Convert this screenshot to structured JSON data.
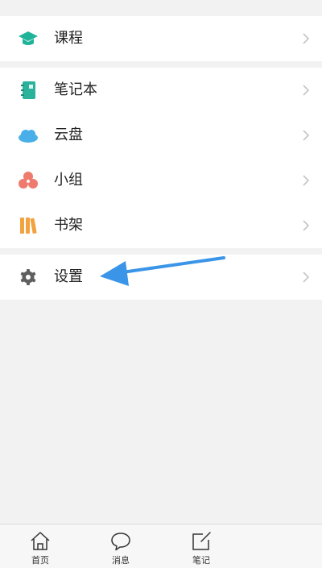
{
  "menu_groups": [
    {
      "items": [
        {
          "label": "课程",
          "icon": "graduation-cap-icon",
          "color": "#1fb39a"
        }
      ]
    },
    {
      "items": [
        {
          "label": "笔记本",
          "icon": "notebook-icon",
          "color": "#2ab39a"
        },
        {
          "label": "云盘",
          "icon": "cloud-icon",
          "color": "#4aaee8"
        },
        {
          "label": "小组",
          "icon": "group-icon",
          "color": "#ee7b6d"
        },
        {
          "label": "书架",
          "icon": "bookshelf-icon",
          "color": "#f3a240"
        }
      ]
    },
    {
      "items": [
        {
          "label": "设置",
          "icon": "gear-icon",
          "color": "#5f5f5f"
        }
      ]
    }
  ],
  "annotation": {
    "icon": "pointer-arrow",
    "color": "#3a95e8"
  },
  "tab_bar": {
    "tabs": [
      {
        "label": "首页",
        "icon": "home-icon"
      },
      {
        "label": "消息",
        "icon": "chat-bubble-icon"
      },
      {
        "label": "笔记",
        "icon": "edit-note-icon"
      }
    ]
  }
}
